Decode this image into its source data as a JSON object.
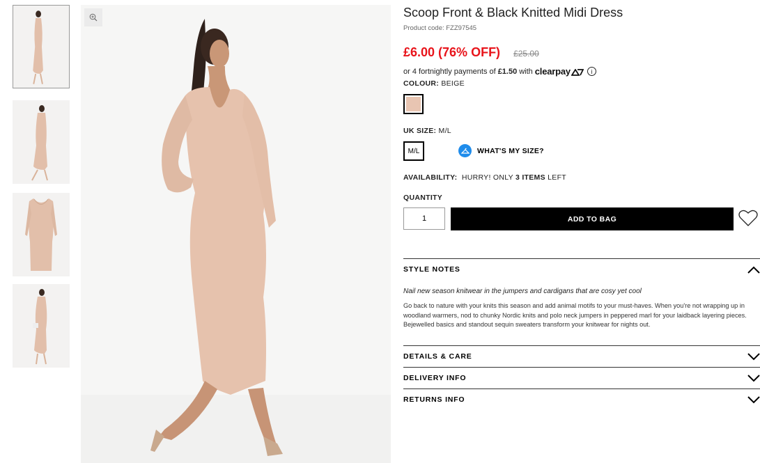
{
  "product": {
    "title": "Scoop Front & Black Knitted Midi Dress",
    "product_code": "Product code: FZZ97545",
    "price": "£6.00 (76% OFF)",
    "was_price": "£25.00",
    "clearpay_prefix": "or 4 fortnightly payments of",
    "clearpay_amount": "£1.50",
    "clearpay_with": "with",
    "clearpay_brand": "clearpay"
  },
  "colour": {
    "label": "COLOUR:",
    "value": "BEIGE",
    "swatch_color": "#e8c5b2"
  },
  "size": {
    "label": "UK SIZE:",
    "value": "M/L",
    "option": "M/L",
    "whats_my_size": "WHAT'S MY SIZE?"
  },
  "availability": {
    "label": "AVAILABILITY:",
    "prefix": "HURRY! ONLY",
    "count": "3",
    "items": "ITEMS",
    "suffix": "LEFT"
  },
  "quantity": {
    "label": "QUANTITY",
    "value": "1"
  },
  "add_to_bag": "ADD TO BAG",
  "accordions": {
    "style_notes": {
      "title": "STYLE NOTES",
      "lead": "Nail new season knitwear in the jumpers and cardigans that are cosy yet cool",
      "body": "Go back to nature with your knits this season and add animal motifs to your must-haves. When you're not wrapping up in woodland warmers, nod to chunky Nordic knits and polo neck jumpers in peppered marl for your laidback layering pieces. Bejewelled basics and standout sequin sweaters transform your knitwear for nights out."
    },
    "details": {
      "title": "DETAILS & CARE"
    },
    "delivery": {
      "title": "DELIVERY INFO"
    },
    "returns": {
      "title": "RETURNS INFO"
    }
  },
  "icons": {
    "zoom": "magnify-plus-icon",
    "info": "info-icon",
    "hanger": "hanger-icon",
    "wishlist": "heart-icon",
    "expand": "chevron-icon"
  },
  "colors": {
    "price_red": "#e8141b",
    "button_black": "#000000",
    "size_blue": "#1f8ceb"
  }
}
